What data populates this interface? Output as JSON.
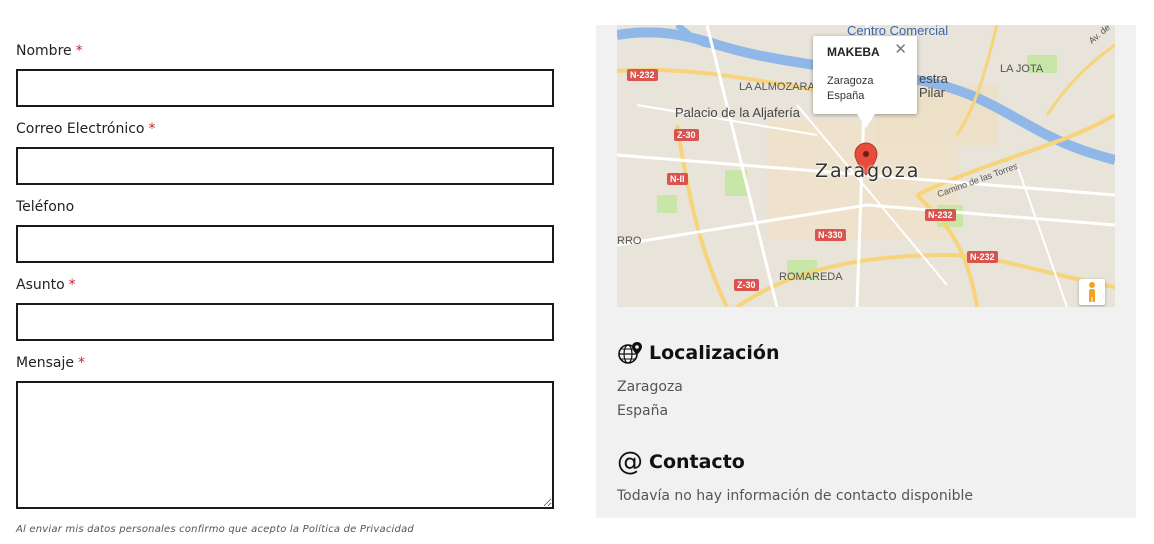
{
  "form": {
    "fields": [
      {
        "label": "Nombre",
        "required_mark": "*"
      },
      {
        "label": "Correo Electrónico",
        "required_mark": "*"
      },
      {
        "label": "Teléfono",
        "required_mark": ""
      },
      {
        "label": "Asunto",
        "required_mark": "*"
      },
      {
        "label": "Mensaje",
        "required_mark": "*"
      }
    ],
    "privacy_note": "Al enviar mis datos personales confirmo que acepto la Política de Privacidad"
  },
  "map": {
    "popup": {
      "title": "MAKEBA",
      "close_symbol": "✕",
      "line1": "Zaragoza",
      "line2": "España"
    },
    "city_label": "Zaragoza",
    "labels": {
      "centro_comercial": "Centro Comercial",
      "la_almozara": "LA ALMOZARA",
      "la_jota": "LA JOTA",
      "palacio": "Palacio de la Aljafería",
      "estra": "estra",
      "pilar": "Pilar",
      "romareda": "ROMAREDA",
      "rro": "RRO",
      "camino": "Camino de las Torres",
      "av": "Av. de"
    },
    "road_badges": {
      "n232_a": "N-232",
      "z30_a": "Z-30",
      "nii": "N-II",
      "n330": "N-330",
      "z30_b": "Z-30",
      "n232_b": "N-232",
      "n232_c": "N-232"
    },
    "colors": {
      "marker": "#e74c3c",
      "road_badge": "#d9534f",
      "river": "#8fb8e8",
      "highway": "#f7d37a",
      "park": "#c8e6a8"
    }
  },
  "location": {
    "heading": "Localización",
    "icon": "globe-pin-icon",
    "line1": "Zaragoza",
    "line2": "España"
  },
  "contact": {
    "heading": "Contacto",
    "icon": "at-icon",
    "icon_glyph": "@",
    "text": "Todavía no hay información de contacto disponible"
  }
}
